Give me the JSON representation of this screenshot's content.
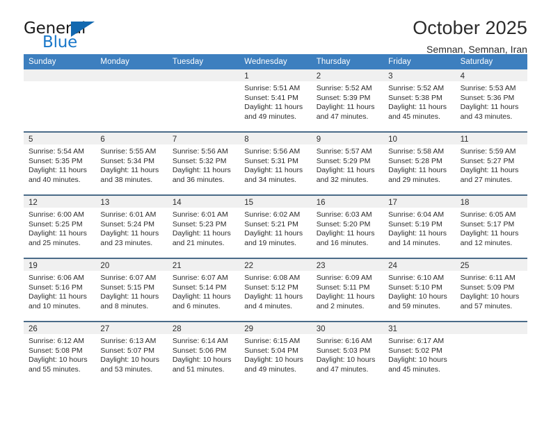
{
  "brand": {
    "name_top": "General",
    "name_bottom": "Blue",
    "flag_icon": "blue-triangle-flag",
    "accent_color": "#1369b0"
  },
  "header": {
    "title": "October 2025",
    "subtitle": "Semnan, Semnan, Iran"
  },
  "theme": {
    "header_row_bg": "#3d7fbf",
    "row_rule": "#4a6b88",
    "day_band_bg": "#f0f0f0"
  },
  "weekdays": [
    "Sunday",
    "Monday",
    "Tuesday",
    "Wednesday",
    "Thursday",
    "Friday",
    "Saturday"
  ],
  "weeks": [
    [
      {
        "day": "",
        "sunrise": "",
        "sunset": "",
        "daylight_1": "",
        "daylight_2": ""
      },
      {
        "day": "",
        "sunrise": "",
        "sunset": "",
        "daylight_1": "",
        "daylight_2": ""
      },
      {
        "day": "",
        "sunrise": "",
        "sunset": "",
        "daylight_1": "",
        "daylight_2": ""
      },
      {
        "day": "1",
        "sunrise": "Sunrise: 5:51 AM",
        "sunset": "Sunset: 5:41 PM",
        "daylight_1": "Daylight: 11 hours",
        "daylight_2": "and 49 minutes."
      },
      {
        "day": "2",
        "sunrise": "Sunrise: 5:52 AM",
        "sunset": "Sunset: 5:39 PM",
        "daylight_1": "Daylight: 11 hours",
        "daylight_2": "and 47 minutes."
      },
      {
        "day": "3",
        "sunrise": "Sunrise: 5:52 AM",
        "sunset": "Sunset: 5:38 PM",
        "daylight_1": "Daylight: 11 hours",
        "daylight_2": "and 45 minutes."
      },
      {
        "day": "4",
        "sunrise": "Sunrise: 5:53 AM",
        "sunset": "Sunset: 5:36 PM",
        "daylight_1": "Daylight: 11 hours",
        "daylight_2": "and 43 minutes."
      }
    ],
    [
      {
        "day": "5",
        "sunrise": "Sunrise: 5:54 AM",
        "sunset": "Sunset: 5:35 PM",
        "daylight_1": "Daylight: 11 hours",
        "daylight_2": "and 40 minutes."
      },
      {
        "day": "6",
        "sunrise": "Sunrise: 5:55 AM",
        "sunset": "Sunset: 5:34 PM",
        "daylight_1": "Daylight: 11 hours",
        "daylight_2": "and 38 minutes."
      },
      {
        "day": "7",
        "sunrise": "Sunrise: 5:56 AM",
        "sunset": "Sunset: 5:32 PM",
        "daylight_1": "Daylight: 11 hours",
        "daylight_2": "and 36 minutes."
      },
      {
        "day": "8",
        "sunrise": "Sunrise: 5:56 AM",
        "sunset": "Sunset: 5:31 PM",
        "daylight_1": "Daylight: 11 hours",
        "daylight_2": "and 34 minutes."
      },
      {
        "day": "9",
        "sunrise": "Sunrise: 5:57 AM",
        "sunset": "Sunset: 5:29 PM",
        "daylight_1": "Daylight: 11 hours",
        "daylight_2": "and 32 minutes."
      },
      {
        "day": "10",
        "sunrise": "Sunrise: 5:58 AM",
        "sunset": "Sunset: 5:28 PM",
        "daylight_1": "Daylight: 11 hours",
        "daylight_2": "and 29 minutes."
      },
      {
        "day": "11",
        "sunrise": "Sunrise: 5:59 AM",
        "sunset": "Sunset: 5:27 PM",
        "daylight_1": "Daylight: 11 hours",
        "daylight_2": "and 27 minutes."
      }
    ],
    [
      {
        "day": "12",
        "sunrise": "Sunrise: 6:00 AM",
        "sunset": "Sunset: 5:25 PM",
        "daylight_1": "Daylight: 11 hours",
        "daylight_2": "and 25 minutes."
      },
      {
        "day": "13",
        "sunrise": "Sunrise: 6:01 AM",
        "sunset": "Sunset: 5:24 PM",
        "daylight_1": "Daylight: 11 hours",
        "daylight_2": "and 23 minutes."
      },
      {
        "day": "14",
        "sunrise": "Sunrise: 6:01 AM",
        "sunset": "Sunset: 5:23 PM",
        "daylight_1": "Daylight: 11 hours",
        "daylight_2": "and 21 minutes."
      },
      {
        "day": "15",
        "sunrise": "Sunrise: 6:02 AM",
        "sunset": "Sunset: 5:21 PM",
        "daylight_1": "Daylight: 11 hours",
        "daylight_2": "and 19 minutes."
      },
      {
        "day": "16",
        "sunrise": "Sunrise: 6:03 AM",
        "sunset": "Sunset: 5:20 PM",
        "daylight_1": "Daylight: 11 hours",
        "daylight_2": "and 16 minutes."
      },
      {
        "day": "17",
        "sunrise": "Sunrise: 6:04 AM",
        "sunset": "Sunset: 5:19 PM",
        "daylight_1": "Daylight: 11 hours",
        "daylight_2": "and 14 minutes."
      },
      {
        "day": "18",
        "sunrise": "Sunrise: 6:05 AM",
        "sunset": "Sunset: 5:17 PM",
        "daylight_1": "Daylight: 11 hours",
        "daylight_2": "and 12 minutes."
      }
    ],
    [
      {
        "day": "19",
        "sunrise": "Sunrise: 6:06 AM",
        "sunset": "Sunset: 5:16 PM",
        "daylight_1": "Daylight: 11 hours",
        "daylight_2": "and 10 minutes."
      },
      {
        "day": "20",
        "sunrise": "Sunrise: 6:07 AM",
        "sunset": "Sunset: 5:15 PM",
        "daylight_1": "Daylight: 11 hours",
        "daylight_2": "and 8 minutes."
      },
      {
        "day": "21",
        "sunrise": "Sunrise: 6:07 AM",
        "sunset": "Sunset: 5:14 PM",
        "daylight_1": "Daylight: 11 hours",
        "daylight_2": "and 6 minutes."
      },
      {
        "day": "22",
        "sunrise": "Sunrise: 6:08 AM",
        "sunset": "Sunset: 5:12 PM",
        "daylight_1": "Daylight: 11 hours",
        "daylight_2": "and 4 minutes."
      },
      {
        "day": "23",
        "sunrise": "Sunrise: 6:09 AM",
        "sunset": "Sunset: 5:11 PM",
        "daylight_1": "Daylight: 11 hours",
        "daylight_2": "and 2 minutes."
      },
      {
        "day": "24",
        "sunrise": "Sunrise: 6:10 AM",
        "sunset": "Sunset: 5:10 PM",
        "daylight_1": "Daylight: 10 hours",
        "daylight_2": "and 59 minutes."
      },
      {
        "day": "25",
        "sunrise": "Sunrise: 6:11 AM",
        "sunset": "Sunset: 5:09 PM",
        "daylight_1": "Daylight: 10 hours",
        "daylight_2": "and 57 minutes."
      }
    ],
    [
      {
        "day": "26",
        "sunrise": "Sunrise: 6:12 AM",
        "sunset": "Sunset: 5:08 PM",
        "daylight_1": "Daylight: 10 hours",
        "daylight_2": "and 55 minutes."
      },
      {
        "day": "27",
        "sunrise": "Sunrise: 6:13 AM",
        "sunset": "Sunset: 5:07 PM",
        "daylight_1": "Daylight: 10 hours",
        "daylight_2": "and 53 minutes."
      },
      {
        "day": "28",
        "sunrise": "Sunrise: 6:14 AM",
        "sunset": "Sunset: 5:06 PM",
        "daylight_1": "Daylight: 10 hours",
        "daylight_2": "and 51 minutes."
      },
      {
        "day": "29",
        "sunrise": "Sunrise: 6:15 AM",
        "sunset": "Sunset: 5:04 PM",
        "daylight_1": "Daylight: 10 hours",
        "daylight_2": "and 49 minutes."
      },
      {
        "day": "30",
        "sunrise": "Sunrise: 6:16 AM",
        "sunset": "Sunset: 5:03 PM",
        "daylight_1": "Daylight: 10 hours",
        "daylight_2": "and 47 minutes."
      },
      {
        "day": "31",
        "sunrise": "Sunrise: 6:17 AM",
        "sunset": "Sunset: 5:02 PM",
        "daylight_1": "Daylight: 10 hours",
        "daylight_2": "and 45 minutes."
      },
      {
        "day": "",
        "sunrise": "",
        "sunset": "",
        "daylight_1": "",
        "daylight_2": ""
      }
    ]
  ]
}
